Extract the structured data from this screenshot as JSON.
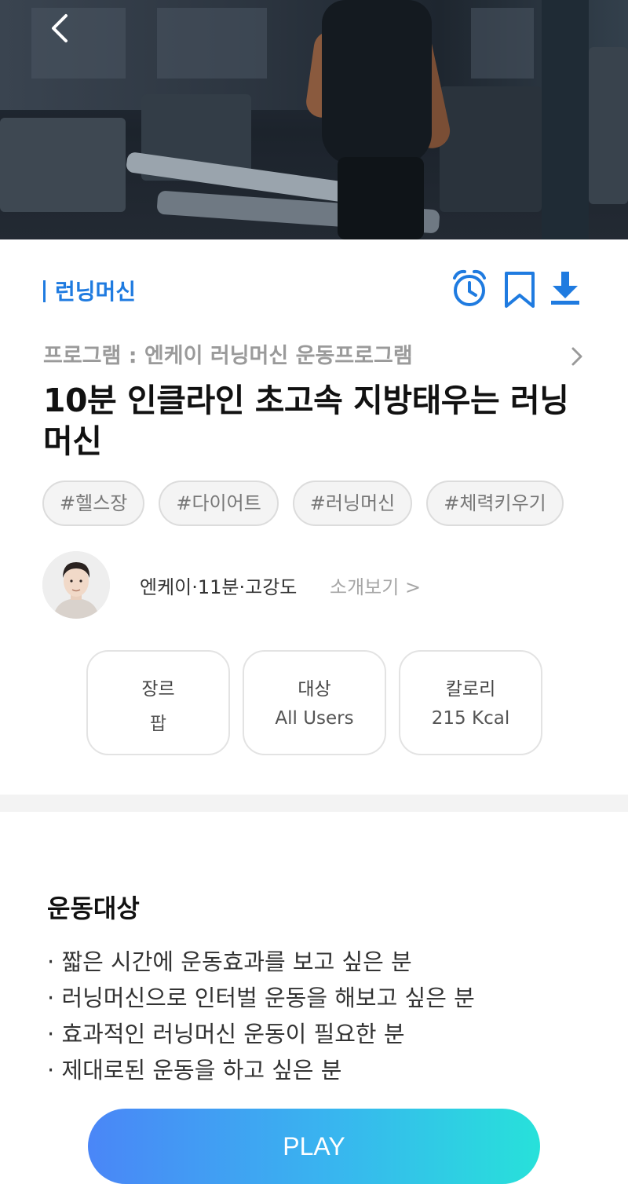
{
  "header": {
    "back_icon": "chevron-left-icon",
    "hero_image": "treadmill-runner-photo"
  },
  "category": {
    "label": "런닝머신",
    "accent_color": "#1f7be0"
  },
  "actions": {
    "alarm_icon": "alarm-clock-icon",
    "bookmark_icon": "bookmark-icon",
    "download_icon": "download-icon"
  },
  "program": {
    "label": "프로그램 : 엔케이 러닝머신 운동프로그램"
  },
  "title": "10분 인클라인 초고속 지방태우는 러닝머신",
  "tags": [
    "#헬스장",
    "#다이어트",
    "#러닝머신",
    "#체력키우기"
  ],
  "author": {
    "meta": "엔케이·11분·고강도",
    "intro_link": "소개보기 >"
  },
  "info": [
    {
      "label": "장르",
      "value": "팝"
    },
    {
      "label": "대상",
      "value": "All Users"
    },
    {
      "label": "칼로리",
      "value": "215 Kcal"
    }
  ],
  "target_section": {
    "title": "운동대상",
    "items": [
      "짧은 시간에 운동효과를 보고 싶은 분",
      "러닝머신으로 인터벌 운동을 해보고 싶은 분",
      "효과적인 러닝머신 운동이 필요한 분",
      "제대로된 운동을 하고 싶은 분"
    ]
  },
  "play": {
    "label": "PLAY",
    "gradient": [
      "#4a86f7",
      "#27e1da"
    ]
  }
}
